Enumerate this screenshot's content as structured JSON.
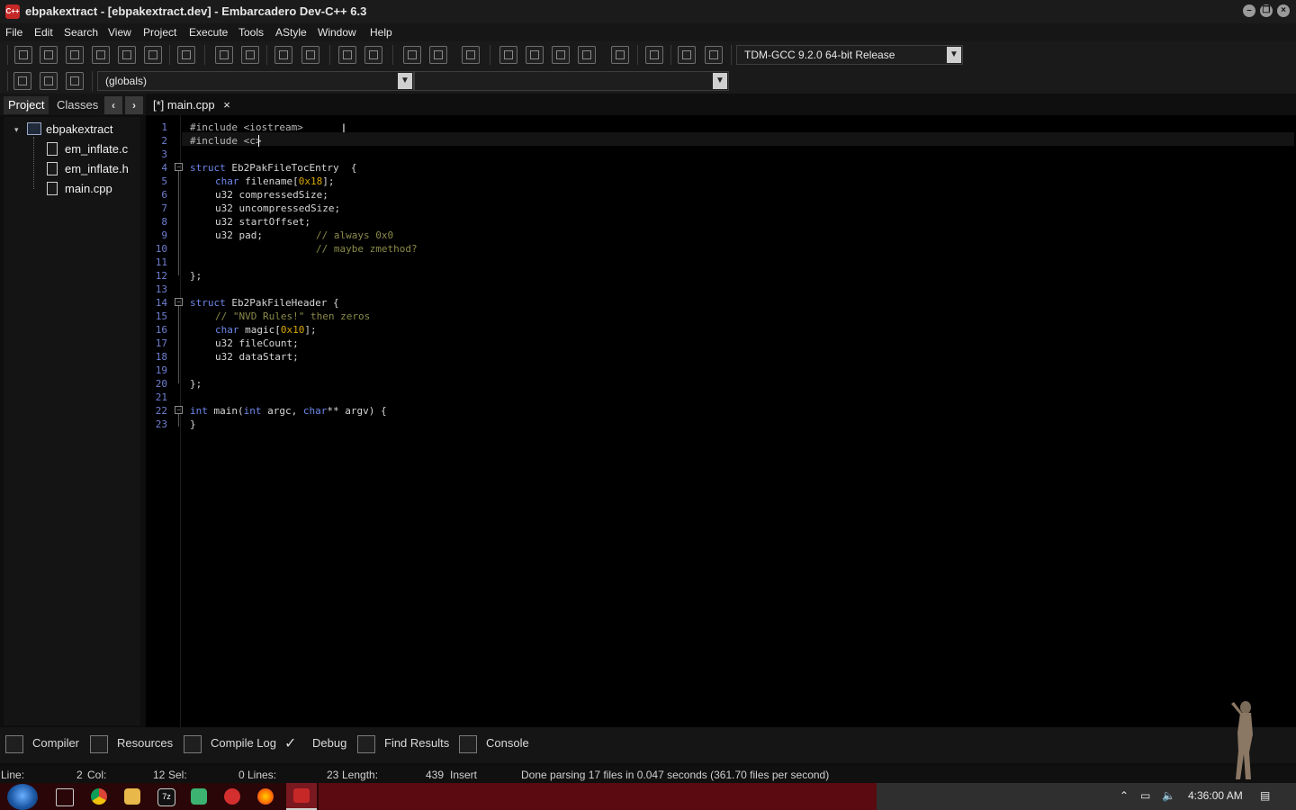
{
  "window": {
    "title": "ebpakextract - [ebpakextract.dev] - Embarcadero Dev-C++ 6.3",
    "icon_text": "C++"
  },
  "menu": [
    "File",
    "Edit",
    "Search",
    "View",
    "Project",
    "Execute",
    "Tools",
    "AStyle",
    "Window",
    "Help"
  ],
  "toolbar": {
    "compiler_select": "TDM-GCC 9.2.0 64-bit Release",
    "scope_select": "(globals)",
    "member_select": ""
  },
  "left_panel": {
    "tabs": [
      "Project",
      "Classes"
    ],
    "nav_prev": "‹",
    "nav_next": "›",
    "project_name": "ebpakextract",
    "files": [
      "em_inflate.c",
      "em_inflate.h",
      "main.cpp"
    ]
  },
  "editor": {
    "tab_label": "[*] main.cpp",
    "tab_close": "×",
    "line_numbers": [
      "1",
      "2",
      "3",
      "4",
      "5",
      "6",
      "7",
      "8",
      "9",
      "10",
      "11",
      "12",
      "13",
      "14",
      "15",
      "16",
      "17",
      "18",
      "19",
      "20",
      "21",
      "22",
      "23"
    ],
    "code": {
      "l1": "#include <iostream>",
      "l2": "#include <c>",
      "l4a": "struct",
      "l4b": " Eb2PakFileTocEntry  {",
      "l5a": "char",
      "l5b": " filename[",
      "l5c": "0x18",
      "l5d": "];",
      "l6": "u32 compressedSize;",
      "l7": "u32 uncompressedSize;",
      "l8": "u32 startOffset;",
      "l9a": "u32 pad;",
      "l9b": "// always 0x0",
      "l10": "// maybe zmethod?",
      "l12": "};",
      "l14a": "struct",
      "l14b": " Eb2PakFileHeader {",
      "l15": "// \"NVD Rules!\" then zeros",
      "l16a": "char",
      "l16b": " magic[",
      "l16c": "0x10",
      "l16d": "];",
      "l17": "u32 fileCount;",
      "l18": "u32 dataStart;",
      "l20": "};",
      "l22a": "int",
      "l22b": " main(",
      "l22c": "int",
      "l22d": " argc, ",
      "l22e": "char",
      "l22f": "** argv) {",
      "l23": "}"
    }
  },
  "bottom_tabs": [
    "Compiler",
    "Resources",
    "Compile Log",
    "Debug",
    "Find Results",
    "Console"
  ],
  "status": {
    "line_label": "Line:",
    "line_value": "2",
    "col_label": "Col:",
    "col_value": "12",
    "sel_label": "Sel:",
    "sel_value": "0",
    "lines_label": "Lines:",
    "lines_value": "23",
    "length_label": "Length:",
    "length_value": "439",
    "mode": "Insert",
    "message": "Done parsing 17 files in 0.047 seconds (361.70 files per second)"
  },
  "taskbar": {
    "clock": "4:36:00 AM"
  },
  "colors": {
    "keyword": "#6e87ea",
    "number": "#d7a600",
    "comment": "#8a8a4a",
    "line_number": "#6f7fd0",
    "taskbar_red": "#5a0a10"
  }
}
